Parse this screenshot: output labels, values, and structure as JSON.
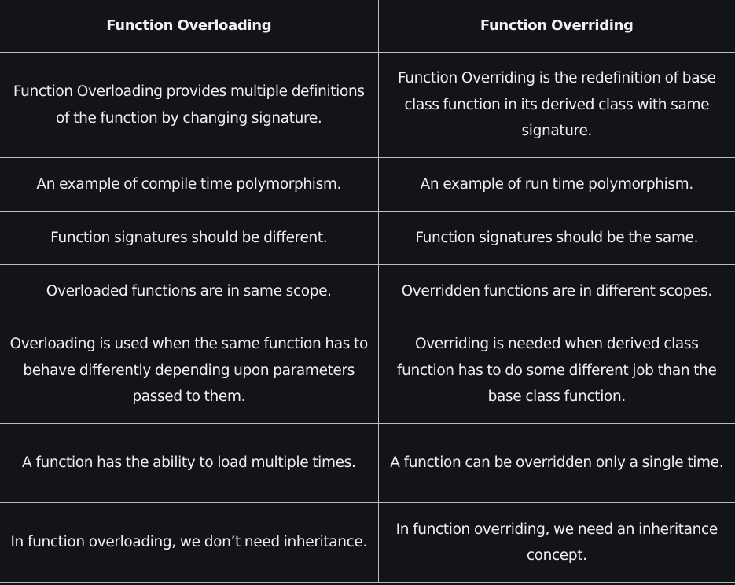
{
  "table": {
    "headers": [
      "Function Overloading",
      "Function Overriding"
    ],
    "rows": [
      [
        "Function Overloading provides multiple definitions of the function by changing signature.",
        "Function Overriding is the redefinition of base class function in its derived class with same signature."
      ],
      [
        "An example of compile time polymorphism.",
        "An example of run time polymorphism."
      ],
      [
        "Function signatures should be different.",
        "Function signatures should be the same."
      ],
      [
        "Overloaded functions are in same scope.",
        "Overridden functions are in different scopes."
      ],
      [
        "Overloading is used when the same function has to behave differently depending upon parameters passed to them.",
        "Overriding is needed when derived class function has to do some different job than the base class function."
      ],
      [
        "A function has the ability to load multiple times.",
        "A function can be overridden only a single time."
      ],
      [
        "In function overloading, we don’t need inheritance.",
        "In function overriding, we need an inheritance concept."
      ]
    ]
  }
}
